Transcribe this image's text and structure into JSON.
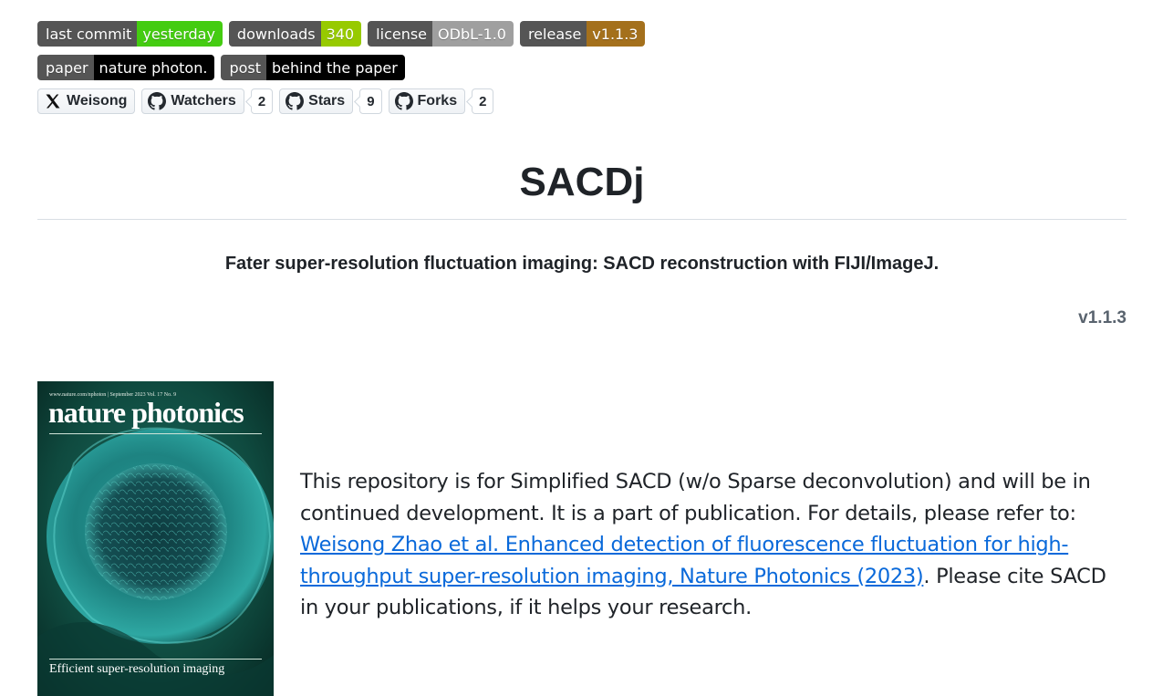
{
  "badges": [
    {
      "label": "last commit",
      "value": "yesterday",
      "color": "#4c1"
    },
    {
      "label": "downloads",
      "value": "340",
      "color": "#97ca00"
    },
    {
      "label": "license",
      "value": "ODbL-1.0",
      "color": "#9f9f9f"
    },
    {
      "label": "release",
      "value": "v1.1.3",
      "color": "#a4701c"
    }
  ],
  "links": [
    {
      "label": "paper",
      "value": "nature photon.",
      "color": "#000000"
    },
    {
      "label": "post",
      "value": "behind the paper",
      "color": "#000000"
    }
  ],
  "social": {
    "x_label": "Weisong",
    "watchers_label": "Watchers",
    "watchers_count": "2",
    "stars_label": "Stars",
    "stars_count": "9",
    "forks_label": "Forks",
    "forks_count": "2"
  },
  "title": "SACDj",
  "subtitle": "Fater super-resolution fluctuation imaging: SACD reconstruction with FIJI/ImageJ.",
  "version": "v1.1.3",
  "cover": {
    "header_url": "www.nature.com/nphoton | September 2023 Vol. 17 No. 9",
    "journal": "nature photonics",
    "tagline": "Efficient super-resolution imaging"
  },
  "description": {
    "intro": "This repository is for Simplified SACD (w/o Sparse deconvolution) and will be in continued development. It is a part of publication. For details, please refer to: ",
    "link_text": "Weisong Zhao et al. Enhanced detection of fluorescence fluctuation for high-throughput super-resolution imaging, Nature Photonics (2023)",
    "outro": ". Please cite SACD in your publications, if it helps your research."
  }
}
